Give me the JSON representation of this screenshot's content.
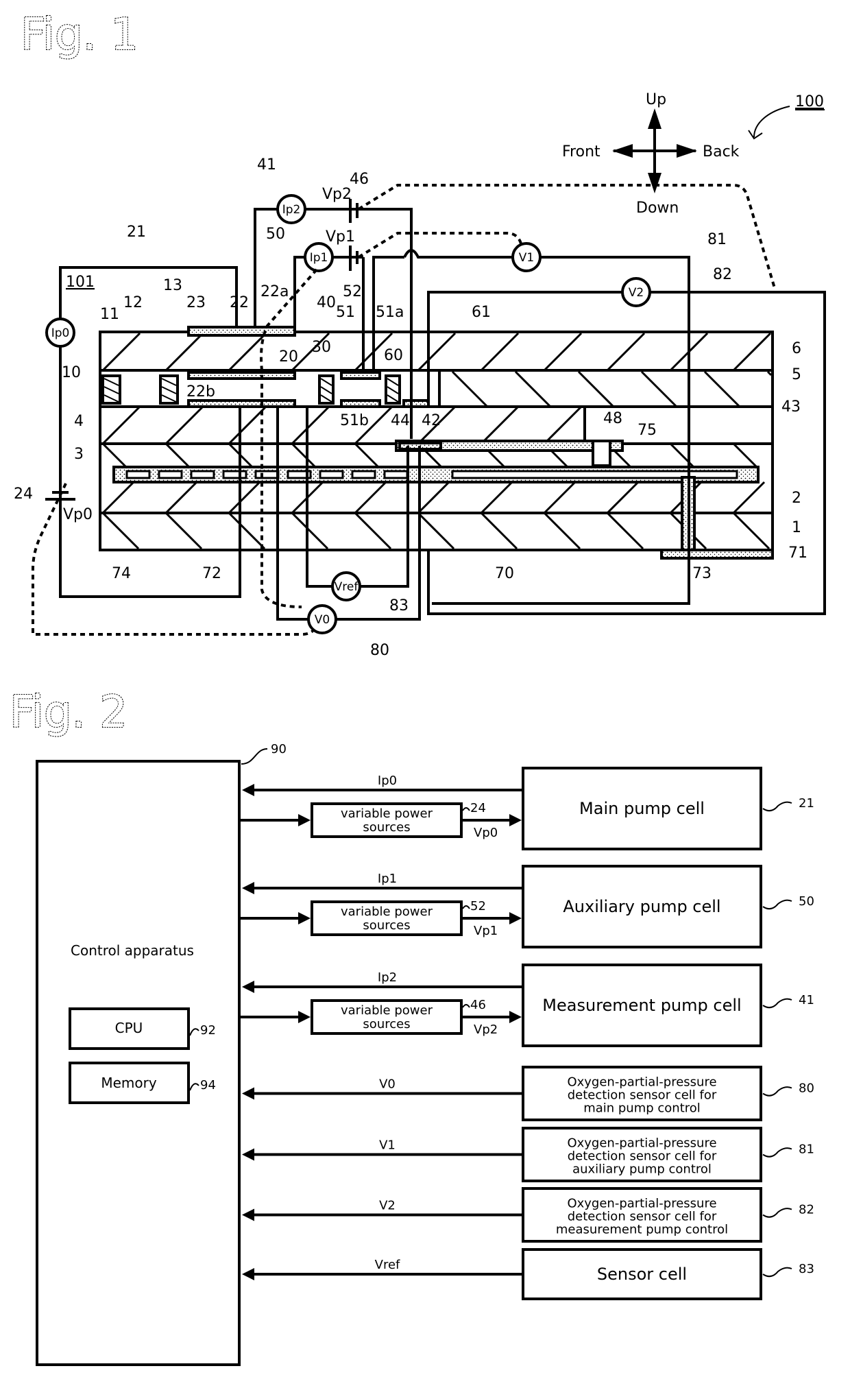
{
  "figure1": {
    "title": "Fig. 1",
    "ref_overall": "100",
    "ref_element": "101",
    "directions": {
      "up": "Up",
      "down": "Down",
      "front": "Front",
      "back": "Back"
    },
    "meters": {
      "ip0": "Ip0",
      "ip1": "Ip1",
      "ip2": "Ip2",
      "v0": "V0",
      "v1": "V1",
      "v2": "V2",
      "vref": "Vref"
    },
    "voltages": {
      "vp0": "Vp0",
      "vp1": "Vp1",
      "vp2": "Vp2"
    },
    "refs": {
      "r1": "1",
      "r2": "2",
      "r3": "3",
      "r4": "4",
      "r5": "5",
      "r6": "6",
      "r10": "10",
      "r11": "11",
      "r12": "12",
      "r13": "13",
      "r20": "20",
      "r21": "21",
      "r22": "22",
      "r22a": "22a",
      "r22b": "22b",
      "r23": "23",
      "r24": "24",
      "r30": "30",
      "r40": "40",
      "r41": "41",
      "r42": "42",
      "r43": "43",
      "r44": "44",
      "r46": "46",
      "r48": "48",
      "r50": "50",
      "r51": "51",
      "r51a": "51a",
      "r51b": "51b",
      "r52": "52",
      "r60": "60",
      "r61": "61",
      "r70": "70",
      "r71": "71",
      "r72": "72",
      "r73": "73",
      "r74": "74",
      "r75": "75",
      "r80": "80",
      "r81": "81",
      "r82": "82",
      "r83": "83"
    }
  },
  "figure2": {
    "title": "Fig. 2",
    "control": {
      "label": "Control apparatus",
      "ref": "90",
      "cpu": "CPU",
      "cpu_ref": "92",
      "memory": "Memory",
      "memory_ref": "94"
    },
    "power_sources": [
      {
        "label_line1": "variable power",
        "label_line2": "sources",
        "ref": "24",
        "output": "Vp0"
      },
      {
        "label_line1": "variable power",
        "label_line2": "sources",
        "ref": "52",
        "output": "Vp1"
      },
      {
        "label_line1": "variable power",
        "label_line2": "sources",
        "ref": "46",
        "output": "Vp2"
      }
    ],
    "cells": [
      {
        "lines": [
          "Main pump cell"
        ],
        "ref": "21",
        "signal": "Ip0"
      },
      {
        "lines": [
          "Auxiliary pump cell"
        ],
        "ref": "50",
        "signal": "Ip1"
      },
      {
        "lines": [
          "Measurement pump cell"
        ],
        "ref": "41",
        "signal": "Ip2"
      },
      {
        "lines": [
          "Oxygen-partial-pressure",
          "detection sensor cell for",
          "main pump control"
        ],
        "ref": "80",
        "signal": "V0"
      },
      {
        "lines": [
          "Oxygen-partial-pressure",
          "detection sensor cell for",
          "auxiliary pump control"
        ],
        "ref": "81",
        "signal": "V1"
      },
      {
        "lines": [
          "Oxygen-partial-pressure",
          "detection sensor cell for",
          "measurement pump control"
        ],
        "ref": "82",
        "signal": "V2"
      },
      {
        "lines": [
          "Sensor cell"
        ],
        "ref": "83",
        "signal": "Vref"
      }
    ]
  }
}
